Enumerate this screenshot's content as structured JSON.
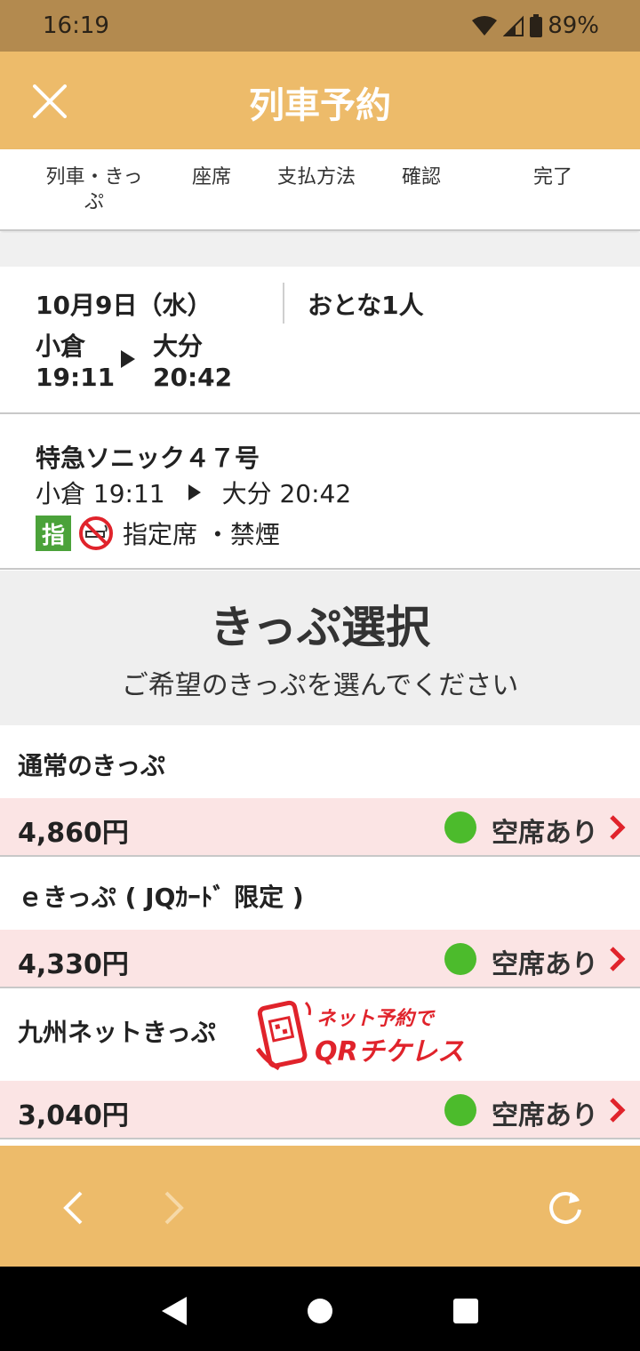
{
  "status_bar": {
    "time": "16:19",
    "battery": "89%"
  },
  "header": {
    "title": "列車予約",
    "close_icon": "close-icon"
  },
  "steps": [
    {
      "line1": "列車・きっ",
      "line2": "ぷ"
    },
    {
      "line1": "座席",
      "line2": ""
    },
    {
      "line1": "支払方法",
      "line2": ""
    },
    {
      "line1": "確認",
      "line2": ""
    },
    {
      "line1": "完了",
      "line2": ""
    }
  ],
  "trip": {
    "date": "10月9日（水）",
    "passengers": "おとな1人",
    "from_station": "小倉",
    "from_time": "19:11",
    "to_station": "大分",
    "to_time": "20:42"
  },
  "train": {
    "name": "特急ソニック４７号",
    "from": "小倉 19:11",
    "to": "大分 20:42",
    "badge": "指",
    "seat_type": "指定席 ・禁煙"
  },
  "section": {
    "title": "きっぷ選択",
    "subtitle": "ご希望のきっぷを選んでください"
  },
  "tickets": [
    {
      "name": "通常のきっぷ",
      "price": "4,860円",
      "availability": "空席あり"
    },
    {
      "name": "ｅきっぷ ( JQｶｰﾄﾞ 限定 )",
      "price": "4,330円",
      "availability": "空席あり"
    },
    {
      "name": "九州ネットきっぷ",
      "price": "3,040円",
      "availability": "空席あり",
      "logo_line1": "ネット予約で",
      "logo_line2": "QRチケレス"
    }
  ],
  "colors": {
    "status_bar": "#b38a4f",
    "header": "#edbb6a",
    "price_row": "#fbe4e4",
    "available": "#4cbb2c",
    "chevron": "#e0232b",
    "logo_red": "#e0232b",
    "badge_green": "#4ba23a"
  },
  "nav_icons": [
    "back-icon",
    "forward-icon",
    "reload-icon"
  ]
}
